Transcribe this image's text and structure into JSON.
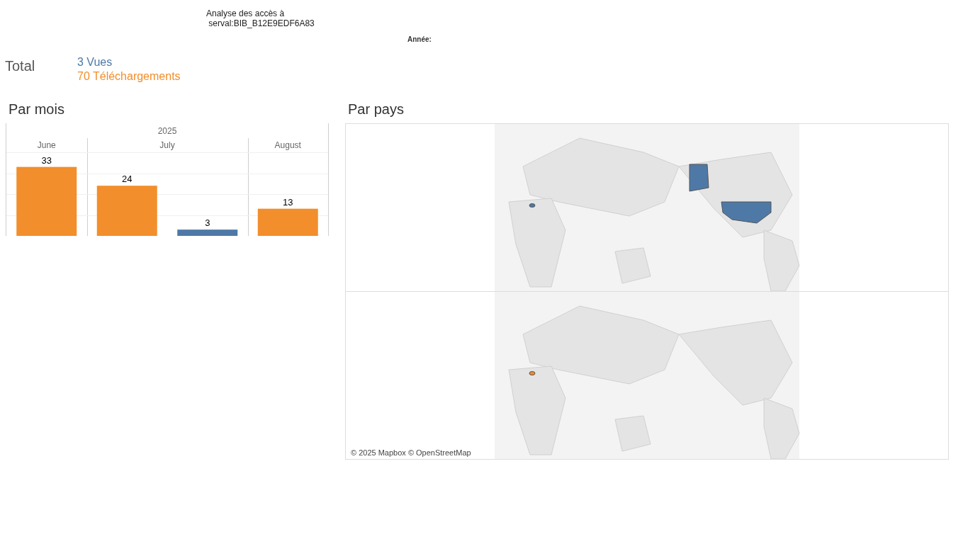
{
  "title": {
    "line_1": "Analyse des accès à",
    "line_2": "serval:BIB_B12E9EDF6A83"
  },
  "filter": {
    "label": "Année:"
  },
  "total": {
    "label": "Total",
    "views": "3 Vues",
    "downloads": "70 Téléchargements"
  },
  "by_month": {
    "heading": "Par mois",
    "chart_data": {
      "type": "bar",
      "title": "2025",
      "categories": [
        "June",
        "July",
        "August"
      ],
      "data_labels": true,
      "series": [
        {
          "color": "#f28e2b",
          "values": [
            33,
            24,
            13
          ]
        },
        {
          "color": "#4e79a7",
          "values": [
            null,
            3,
            null
          ]
        }
      ]
    }
  },
  "by_country": {
    "heading": "Par pays",
    "attribution": "© 2025 Mapbox © OpenStreetMap"
  }
}
